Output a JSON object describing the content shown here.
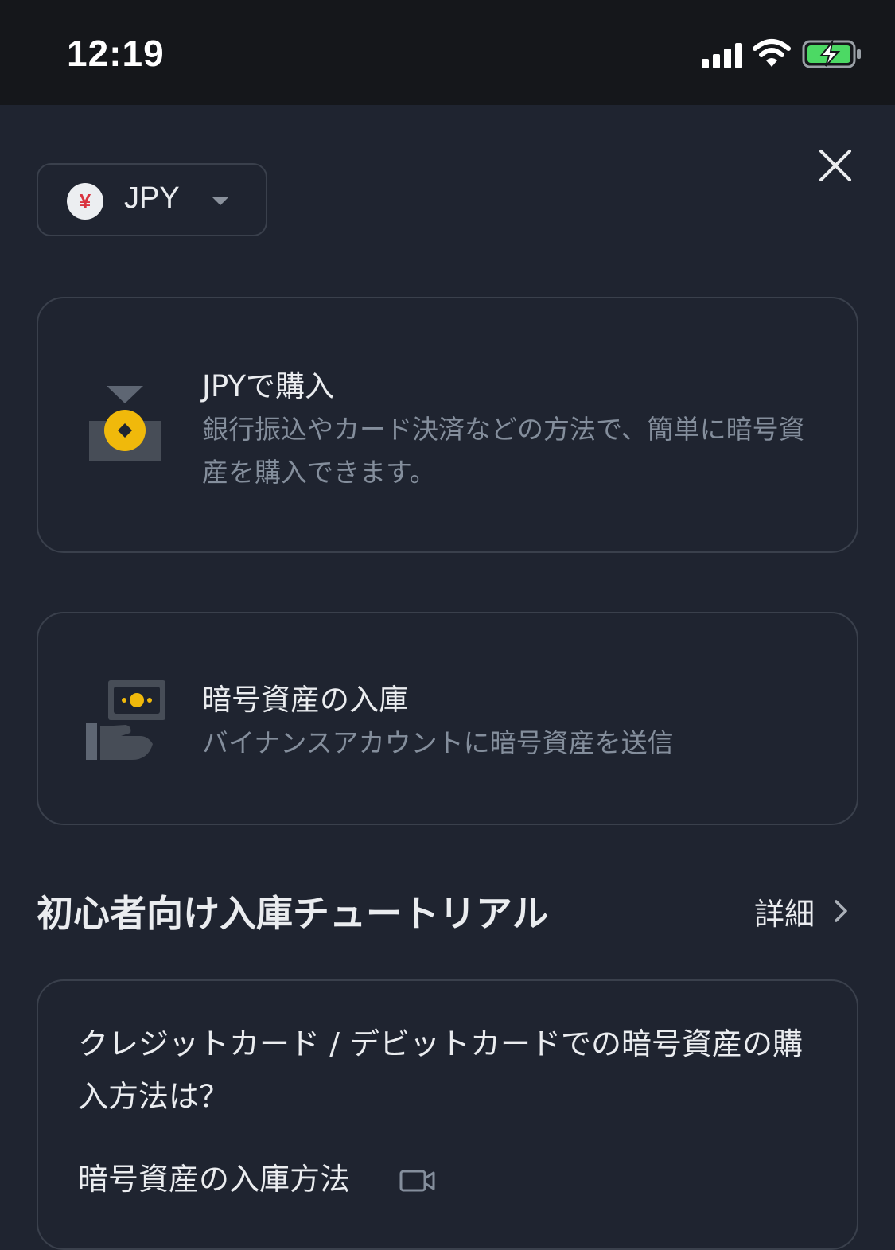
{
  "status_bar": {
    "time": "12:19"
  },
  "currency": {
    "symbol": "¥",
    "label": "JPY"
  },
  "options": [
    {
      "title": "JPYで購入",
      "description": "銀行振込やカード決済などの方法で、簡単に暗号資産を購入できます。",
      "icon": "buy-coin-icon"
    },
    {
      "title": "暗号資産の入庫",
      "description": "バイナンスアカウントに暗号資産を送信",
      "icon": "deposit-hand-icon"
    }
  ],
  "tutorial": {
    "section_title": "初心者向け入庫チュートリアル",
    "more_label": "詳細",
    "items": [
      {
        "label": "クレジットカード / デビットカードでの暗号資産の購入方法は？"
      },
      {
        "label": "暗号資産の入庫方法",
        "icon": "video-icon"
      }
    ]
  },
  "colors": {
    "background": "#1f2430",
    "status_bar": "#15171b",
    "accent": "#f0b90b",
    "secondary_text": "#848e9c",
    "border": "#3a404c"
  }
}
